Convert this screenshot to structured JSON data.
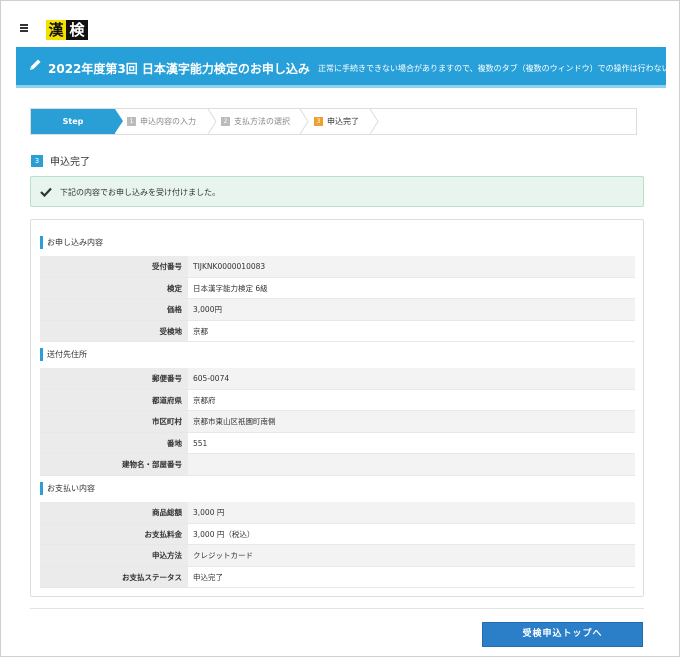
{
  "header": {
    "logo_char_1": "漢",
    "logo_char_2": "検",
    "logo_accent": "#f4e100"
  },
  "banner": {
    "title": "2022年度第3回 日本漢字能力検定のお申し込み",
    "note": "正常に手続きできない場合がありますので、複数のタブ（複数のウィンドウ）での操作は行わないで",
    "color": "#27a0d9"
  },
  "steps": {
    "label": "Step",
    "items": [
      {
        "num": "1",
        "label": "申込内容の入力"
      },
      {
        "num": "2",
        "label": "支払方法の選択"
      },
      {
        "num": "3",
        "label": "申込完了"
      }
    ]
  },
  "section": {
    "num": "3",
    "title": "申込完了"
  },
  "alert": {
    "message": "下記の内容でお申し込みを受け付けました。"
  },
  "application": {
    "title": "お申し込み内容",
    "rows": [
      {
        "label": "受付番号",
        "value": "TIJKNK0000010083"
      },
      {
        "label": "検定",
        "value": "日本漢字能力検定 6級"
      },
      {
        "label": "価格",
        "value": "3,000円"
      },
      {
        "label": "受検地",
        "value": "京都"
      }
    ]
  },
  "address": {
    "title": "送付先住所",
    "rows": [
      {
        "label": "郵便番号",
        "value": "605-0074"
      },
      {
        "label": "都道府県",
        "value": "京都府"
      },
      {
        "label": "市区町村",
        "value": "京都市東山区祇園町南側"
      },
      {
        "label": "番地",
        "value": "551"
      },
      {
        "label": "建物名・部屋番号",
        "value": ""
      }
    ]
  },
  "payment": {
    "title": "お支払い内容",
    "rows": [
      {
        "label": "商品総額",
        "value": "3,000 円"
      },
      {
        "label": "お支払料金",
        "value": "3,000 円（税込）"
      },
      {
        "label": "申込方法",
        "value": "クレジットカード"
      },
      {
        "label": "お支払ステータス",
        "value": "申込完了"
      }
    ]
  },
  "cta": {
    "label": "受検申込トップへ"
  }
}
